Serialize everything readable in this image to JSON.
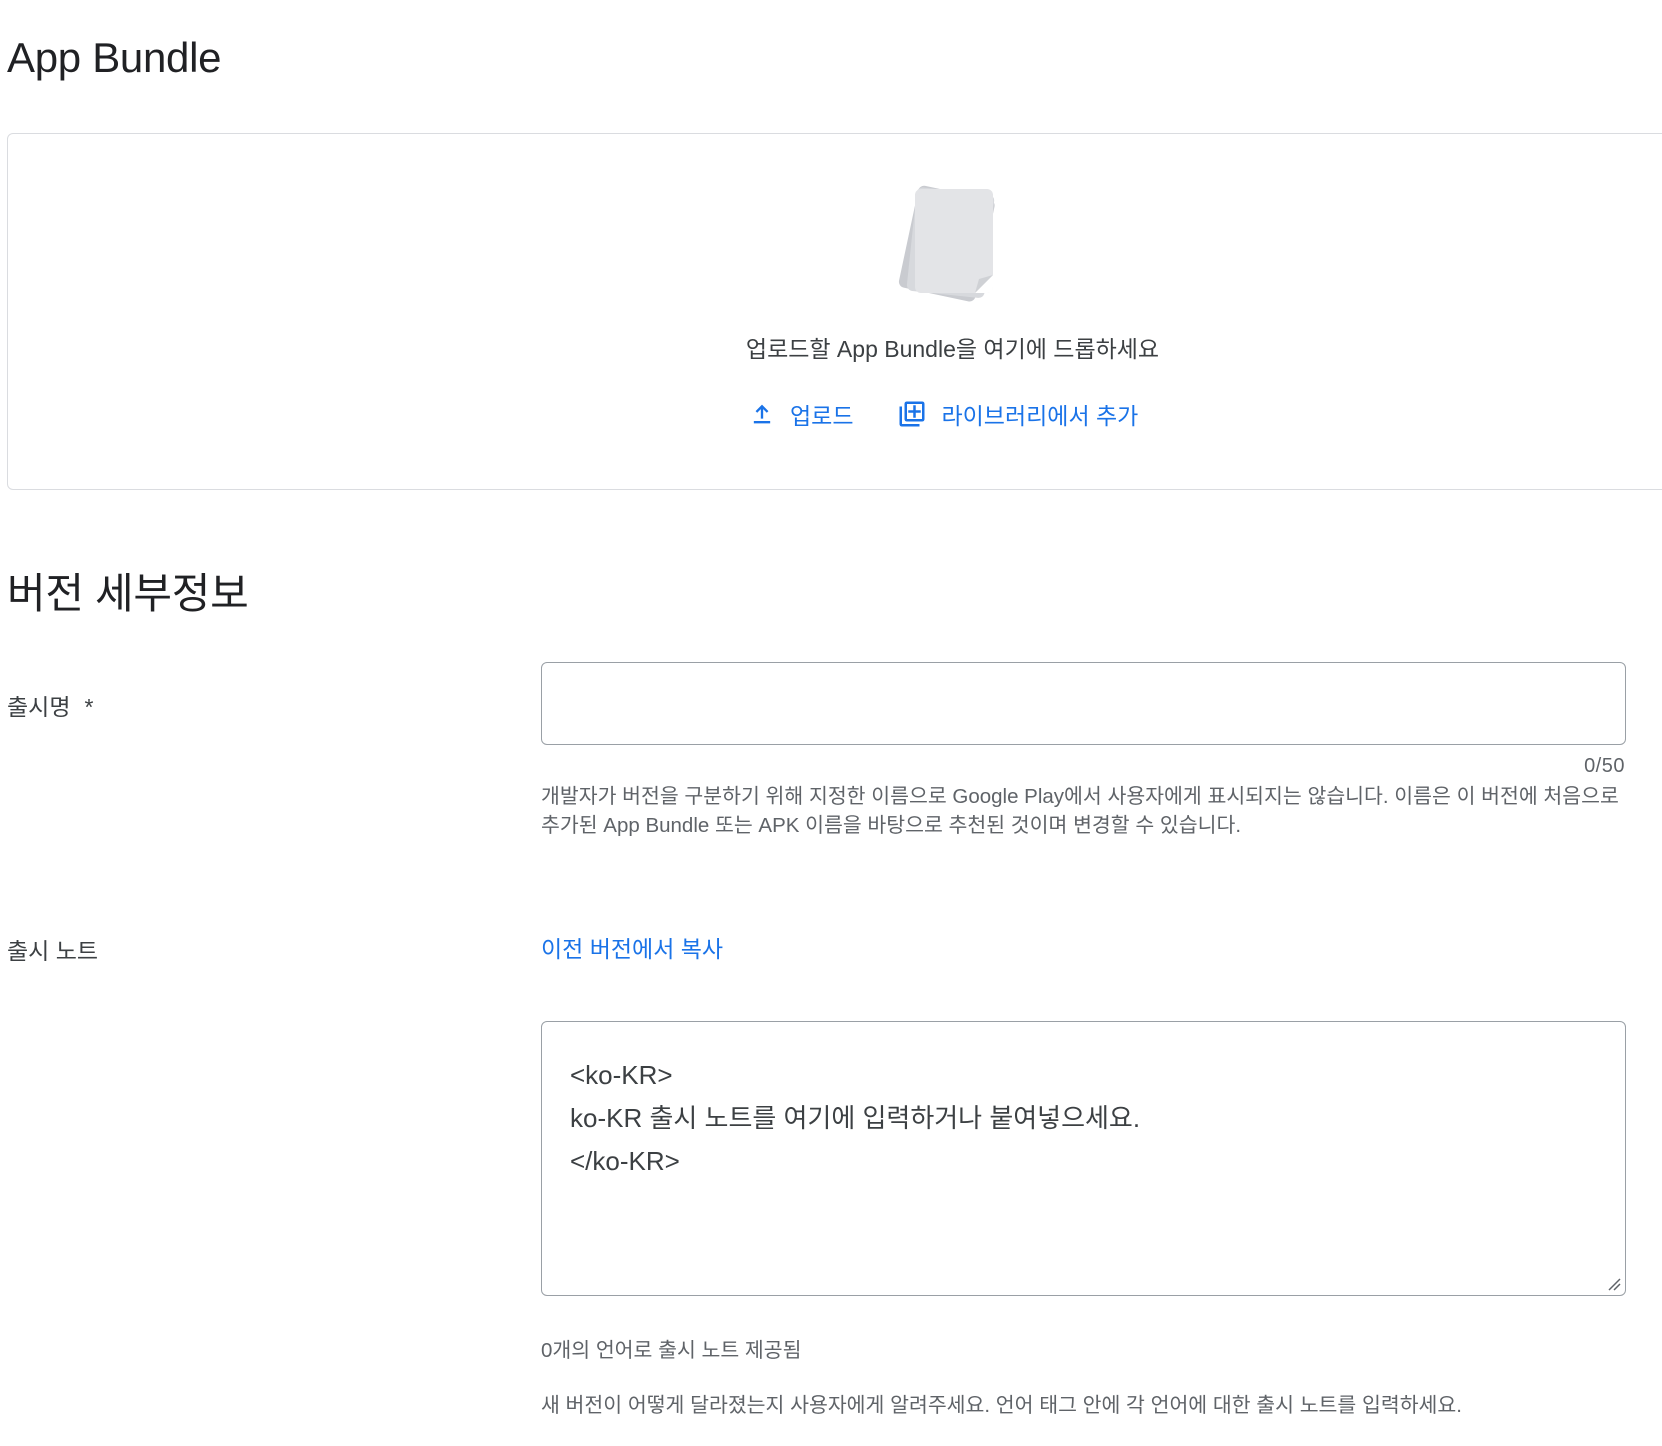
{
  "app_bundle": {
    "title": "App Bundle",
    "drop_text": "업로드할 App Bundle을 여기에 드롭하세요",
    "upload_label": "업로드",
    "add_from_library_label": "라이브러리에서 추가"
  },
  "version_details": {
    "title": "버전 세부정보",
    "release_name": {
      "label": "출시명",
      "required_marker": "*",
      "value": "",
      "counter": "0/50",
      "helper": "개발자가 버전을 구분하기 위해 지정한 이름으로 Google Play에서 사용자에게 표시되지는 않습니다. 이름은 이 버전에 처음으로 추가된 App Bundle 또는 APK 이름을 바탕으로 추천된 것이며 변경할 수 있습니다."
    },
    "release_notes": {
      "label": "출시 노트",
      "copy_link": "이전 버전에서 복사",
      "lines": [
        "<ko-KR>",
        "ko-KR 출시 노트를 여기에 입력하거나 붙여넣으세요.",
        "</ko-KR>"
      ],
      "language_count": "0개의 언어로 출시 노트 제공됨",
      "helper": "새 버전이 어떻게 달라졌는지 사용자에게 알려주세요. 언어 태그 안에 각 언어에 대한 출시 노트를 입력하세요."
    }
  },
  "colors": {
    "link": "#1a73e8",
    "border": "#dadce0",
    "input_border": "#9aa0a6",
    "secondary_text": "#5f6368"
  },
  "icons": {
    "upload": "upload-icon",
    "library_add": "library-add-icon",
    "files_illustration": "files-illustration-icon",
    "resize": "resize-handle-icon"
  }
}
